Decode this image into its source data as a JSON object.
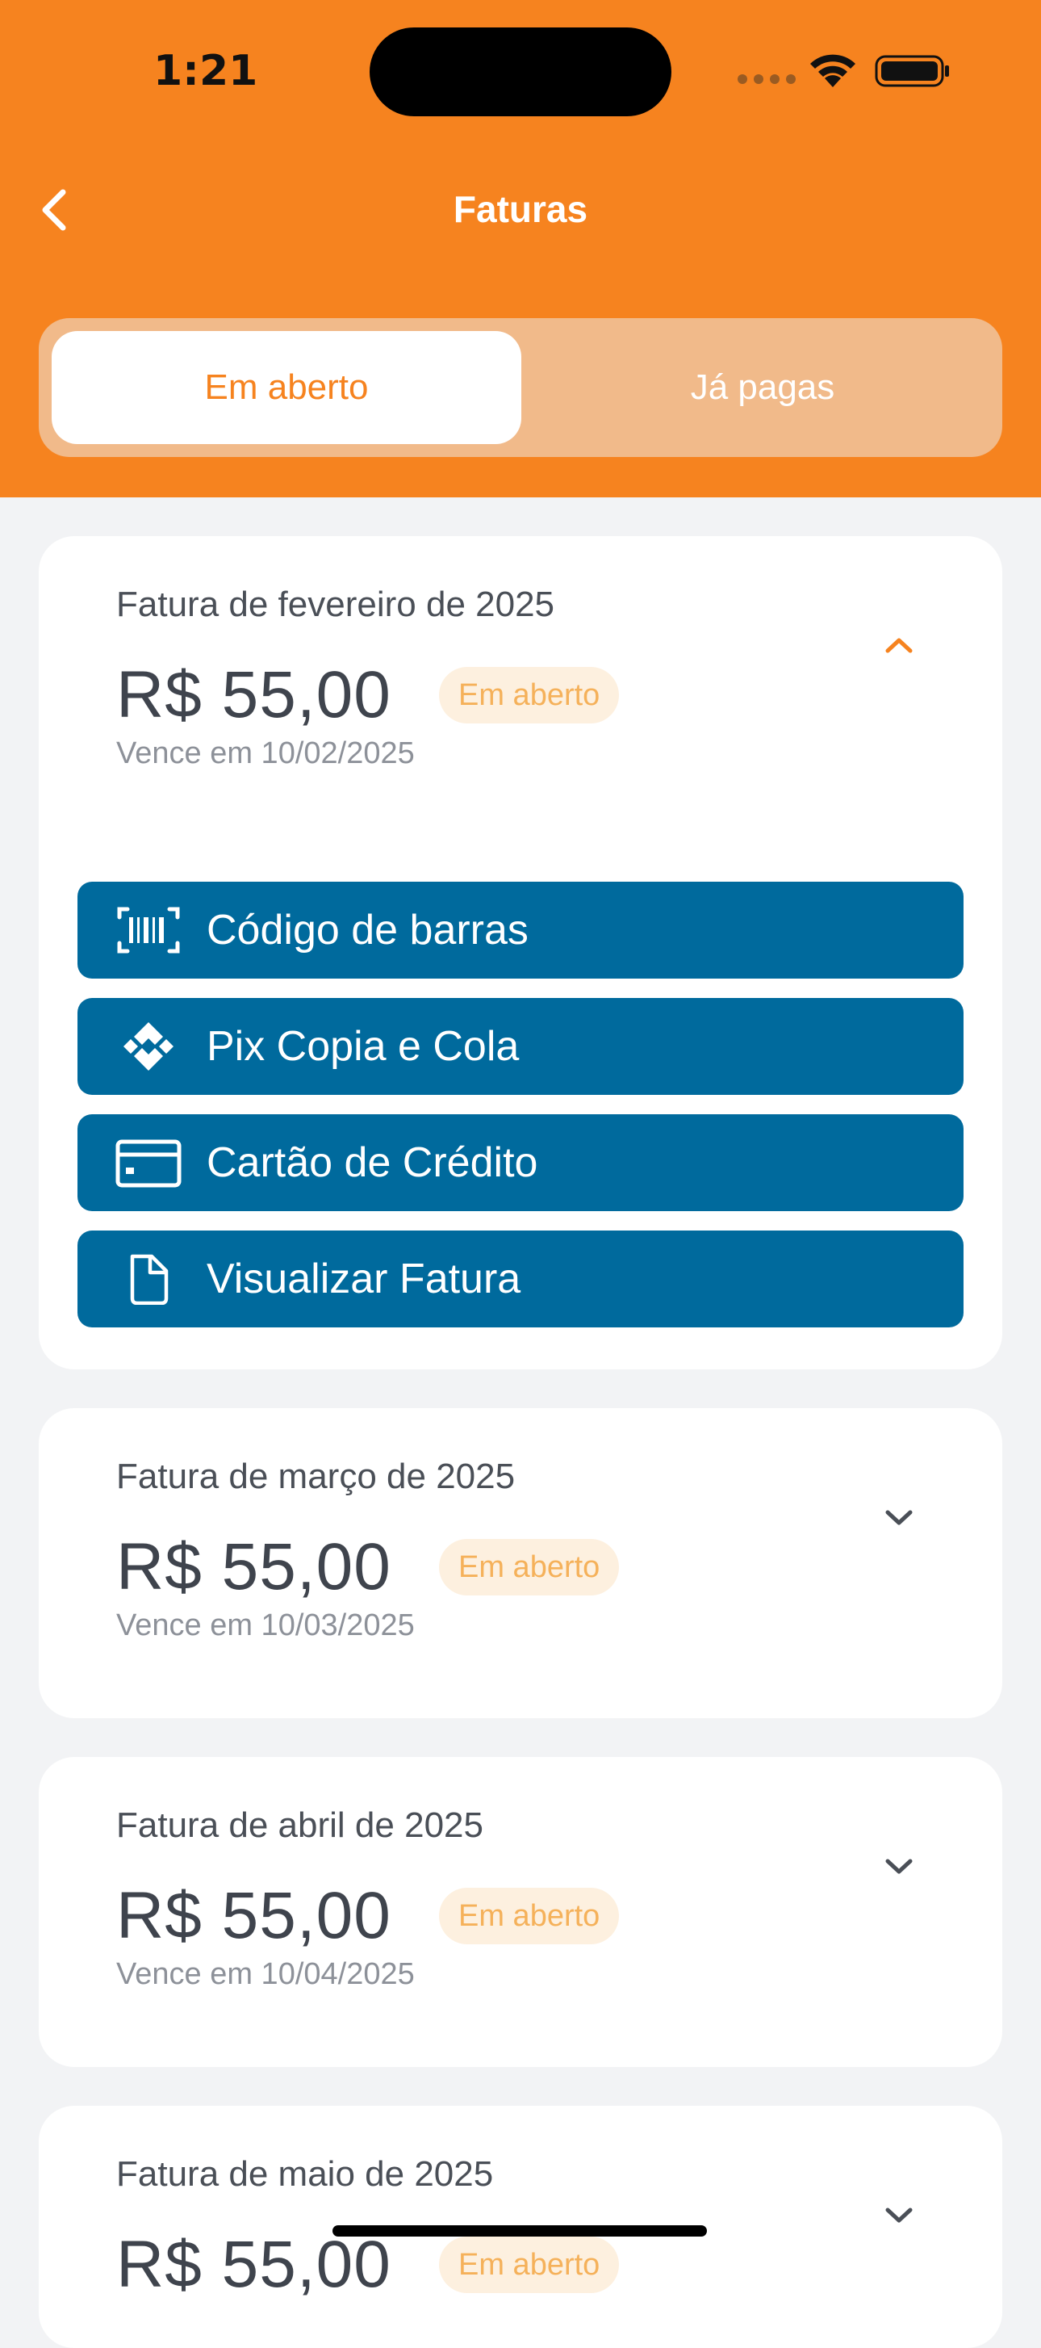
{
  "status_bar": {
    "time": "1:21"
  },
  "header": {
    "title": "Faturas"
  },
  "tabs": [
    {
      "label": "Em aberto",
      "active": true
    },
    {
      "label": "Já pagas",
      "active": false
    }
  ],
  "invoices": [
    {
      "title": "Fatura de fevereiro de 2025",
      "amount": "R$ 55,00",
      "status": "Em aberto",
      "due": "Vence em 10/02/2025",
      "expanded": true,
      "actions": [
        {
          "label": "Código de barras",
          "icon": "barcode-icon"
        },
        {
          "label": "Pix Copia e Cola",
          "icon": "pix-icon"
        },
        {
          "label": "Cartão de Crédito",
          "icon": "credit-card-icon"
        },
        {
          "label": "Visualizar Fatura",
          "icon": "document-icon"
        }
      ]
    },
    {
      "title": "Fatura de março de 2025",
      "amount": "R$ 55,00",
      "status": "Em aberto",
      "due": "Vence em 10/03/2025",
      "expanded": false
    },
    {
      "title": "Fatura de abril de 2025",
      "amount": "R$ 55,00",
      "status": "Em aberto",
      "due": "Vence em 10/04/2025",
      "expanded": false
    },
    {
      "title": "Fatura de maio de 2025",
      "amount": "R$ 55,00",
      "status": "Em aberto",
      "due": "",
      "expanded": false
    }
  ],
  "colors": {
    "brand_orange": "#f6831f",
    "action_blue": "#006a9d",
    "badge_bg": "#fdf0df",
    "badge_text": "#f5b15a"
  }
}
